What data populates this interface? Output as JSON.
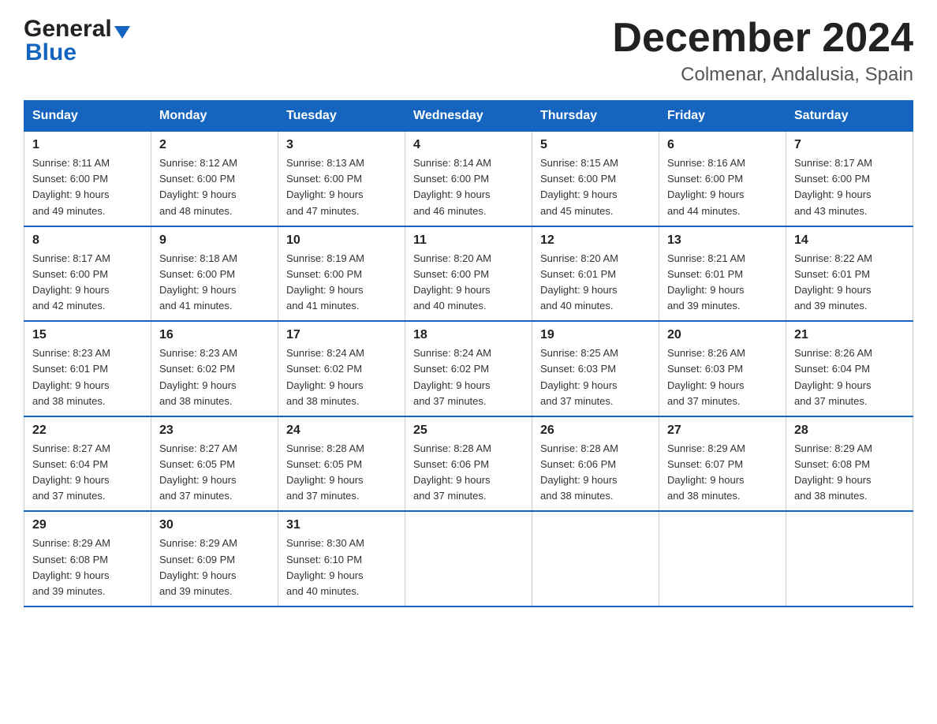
{
  "header": {
    "logo_general": "General",
    "logo_blue": "Blue",
    "title": "December 2024",
    "subtitle": "Colmenar, Andalusia, Spain"
  },
  "days_of_week": [
    "Sunday",
    "Monday",
    "Tuesday",
    "Wednesday",
    "Thursday",
    "Friday",
    "Saturday"
  ],
  "weeks": [
    [
      {
        "day": "1",
        "sunrise": "8:11 AM",
        "sunset": "6:00 PM",
        "daylight": "9 hours and 49 minutes."
      },
      {
        "day": "2",
        "sunrise": "8:12 AM",
        "sunset": "6:00 PM",
        "daylight": "9 hours and 48 minutes."
      },
      {
        "day": "3",
        "sunrise": "8:13 AM",
        "sunset": "6:00 PM",
        "daylight": "9 hours and 47 minutes."
      },
      {
        "day": "4",
        "sunrise": "8:14 AM",
        "sunset": "6:00 PM",
        "daylight": "9 hours and 46 minutes."
      },
      {
        "day": "5",
        "sunrise": "8:15 AM",
        "sunset": "6:00 PM",
        "daylight": "9 hours and 45 minutes."
      },
      {
        "day": "6",
        "sunrise": "8:16 AM",
        "sunset": "6:00 PM",
        "daylight": "9 hours and 44 minutes."
      },
      {
        "day": "7",
        "sunrise": "8:17 AM",
        "sunset": "6:00 PM",
        "daylight": "9 hours and 43 minutes."
      }
    ],
    [
      {
        "day": "8",
        "sunrise": "8:17 AM",
        "sunset": "6:00 PM",
        "daylight": "9 hours and 42 minutes."
      },
      {
        "day": "9",
        "sunrise": "8:18 AM",
        "sunset": "6:00 PM",
        "daylight": "9 hours and 41 minutes."
      },
      {
        "day": "10",
        "sunrise": "8:19 AM",
        "sunset": "6:00 PM",
        "daylight": "9 hours and 41 minutes."
      },
      {
        "day": "11",
        "sunrise": "8:20 AM",
        "sunset": "6:00 PM",
        "daylight": "9 hours and 40 minutes."
      },
      {
        "day": "12",
        "sunrise": "8:20 AM",
        "sunset": "6:01 PM",
        "daylight": "9 hours and 40 minutes."
      },
      {
        "day": "13",
        "sunrise": "8:21 AM",
        "sunset": "6:01 PM",
        "daylight": "9 hours and 39 minutes."
      },
      {
        "day": "14",
        "sunrise": "8:22 AM",
        "sunset": "6:01 PM",
        "daylight": "9 hours and 39 minutes."
      }
    ],
    [
      {
        "day": "15",
        "sunrise": "8:23 AM",
        "sunset": "6:01 PM",
        "daylight": "9 hours and 38 minutes."
      },
      {
        "day": "16",
        "sunrise": "8:23 AM",
        "sunset": "6:02 PM",
        "daylight": "9 hours and 38 minutes."
      },
      {
        "day": "17",
        "sunrise": "8:24 AM",
        "sunset": "6:02 PM",
        "daylight": "9 hours and 38 minutes."
      },
      {
        "day": "18",
        "sunrise": "8:24 AM",
        "sunset": "6:02 PM",
        "daylight": "9 hours and 37 minutes."
      },
      {
        "day": "19",
        "sunrise": "8:25 AM",
        "sunset": "6:03 PM",
        "daylight": "9 hours and 37 minutes."
      },
      {
        "day": "20",
        "sunrise": "8:26 AM",
        "sunset": "6:03 PM",
        "daylight": "9 hours and 37 minutes."
      },
      {
        "day": "21",
        "sunrise": "8:26 AM",
        "sunset": "6:04 PM",
        "daylight": "9 hours and 37 minutes."
      }
    ],
    [
      {
        "day": "22",
        "sunrise": "8:27 AM",
        "sunset": "6:04 PM",
        "daylight": "9 hours and 37 minutes."
      },
      {
        "day": "23",
        "sunrise": "8:27 AM",
        "sunset": "6:05 PM",
        "daylight": "9 hours and 37 minutes."
      },
      {
        "day": "24",
        "sunrise": "8:28 AM",
        "sunset": "6:05 PM",
        "daylight": "9 hours and 37 minutes."
      },
      {
        "day": "25",
        "sunrise": "8:28 AM",
        "sunset": "6:06 PM",
        "daylight": "9 hours and 37 minutes."
      },
      {
        "day": "26",
        "sunrise": "8:28 AM",
        "sunset": "6:06 PM",
        "daylight": "9 hours and 38 minutes."
      },
      {
        "day": "27",
        "sunrise": "8:29 AM",
        "sunset": "6:07 PM",
        "daylight": "9 hours and 38 minutes."
      },
      {
        "day": "28",
        "sunrise": "8:29 AM",
        "sunset": "6:08 PM",
        "daylight": "9 hours and 38 minutes."
      }
    ],
    [
      {
        "day": "29",
        "sunrise": "8:29 AM",
        "sunset": "6:08 PM",
        "daylight": "9 hours and 39 minutes."
      },
      {
        "day": "30",
        "sunrise": "8:29 AM",
        "sunset": "6:09 PM",
        "daylight": "9 hours and 39 minutes."
      },
      {
        "day": "31",
        "sunrise": "8:30 AM",
        "sunset": "6:10 PM",
        "daylight": "9 hours and 40 minutes."
      },
      null,
      null,
      null,
      null
    ]
  ],
  "labels": {
    "sunrise_prefix": "Sunrise: ",
    "sunset_prefix": "Sunset: ",
    "daylight_prefix": "Daylight: "
  }
}
